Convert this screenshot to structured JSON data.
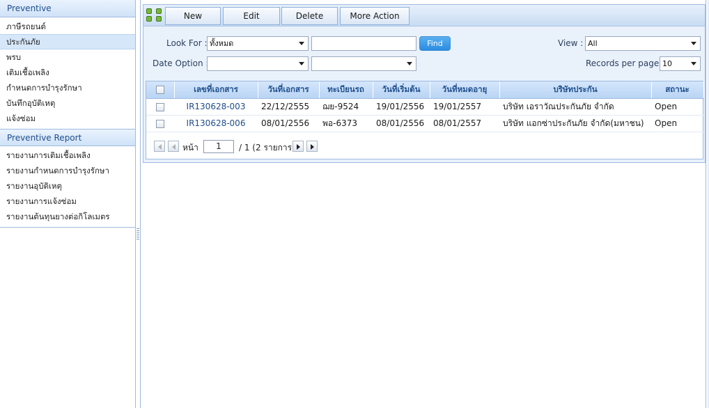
{
  "sidebar": {
    "sections": [
      {
        "title": "Preventive",
        "items": [
          "ภาษีรถยนต์",
          "ประกันภัย",
          "พรบ",
          "เติมเชื้อเพลิง",
          "กำหนดการบำรุงรักษา",
          "บันทึกอุบัติเหตุ",
          "แจ้งซ่อม"
        ],
        "active_index": 1
      },
      {
        "title": "Preventive Report",
        "items": [
          "รายงานการเติมเชื้อเพลิง",
          "รายงานกำหนดการบำรุงรักษา",
          "รายงานอุบัติเหตุ",
          "รายงานการแจ้งซ่อม",
          "รายงานต้นทุนยางต่อกิโลเมตร"
        ]
      }
    ]
  },
  "toolbar": {
    "buttons": [
      "New",
      "Edit",
      "Delete",
      "More Action"
    ]
  },
  "filters": {
    "look_for_label": "Look For :",
    "look_for_value": "ทั้งหมด",
    "search_value": "",
    "find_label": "Find",
    "view_label": "View :",
    "view_value": "All",
    "date_option_label": "Date Option :",
    "date_option_value": "",
    "date_option_value2": "",
    "records_label": "Records per page :",
    "records_value": "10"
  },
  "grid": {
    "columns": [
      "เลขที่เอกสาร",
      "วันที่เอกสาร",
      "ทะเบียนรถ",
      "วันที่เริ่มต้น",
      "วันที่หมดอายุ",
      "บริษัทประกัน",
      "สถานะ"
    ],
    "rows": [
      [
        "IR130628-003",
        "22/12/2555",
        "ฌย-9524",
        "19/01/2556",
        "19/01/2557",
        "บริษัท เอราวัณประกันภัย จำกัด",
        "Open"
      ],
      [
        "IR130628-006",
        "08/01/2556",
        "พอ-6373",
        "08/01/2556",
        "08/01/2557",
        "บริษัท แอกซ่าประกันภัย จำกัด(มหาชน)",
        "Open"
      ]
    ]
  },
  "pager": {
    "page_label": "หน้า",
    "page_value": "1",
    "total_text": "/ 1 (2 รายการ)"
  },
  "colors": {
    "accent": "#1f4e8c",
    "header_bg": "#cfe2f8",
    "find_button": "#2b8ce0"
  }
}
